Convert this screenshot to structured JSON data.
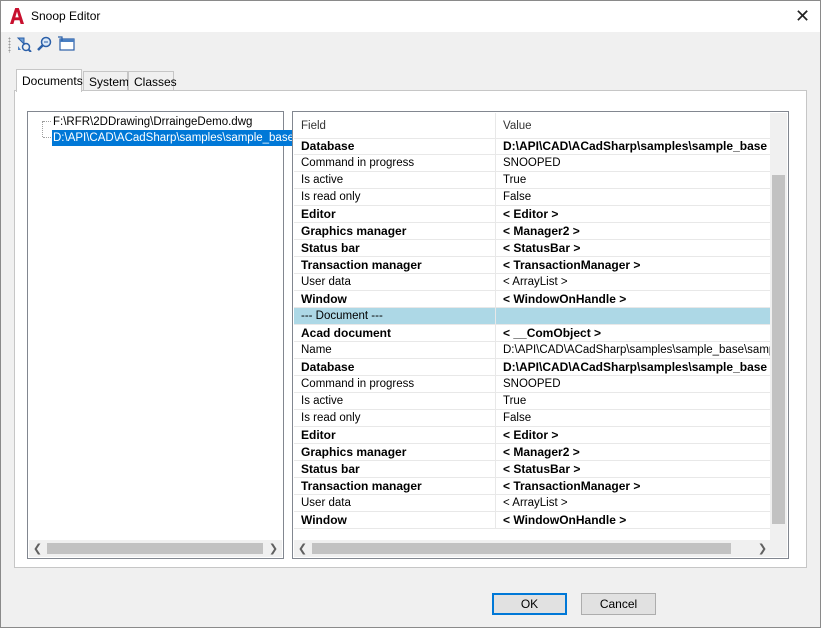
{
  "window": {
    "title": "Snoop Editor",
    "close_symbol": "✕"
  },
  "toolbar": {
    "buttons": [
      {
        "icon": "snoop-entity-icon"
      },
      {
        "icon": "snoop-zoom-icon"
      },
      {
        "icon": "snoop-window-icon"
      }
    ]
  },
  "tabs": [
    {
      "label": "Documents",
      "active": true
    },
    {
      "label": "System",
      "active": false
    },
    {
      "label": "Classes",
      "active": false
    }
  ],
  "tree": {
    "items": [
      {
        "label": "F:\\RFR\\2DDrawing\\DrraingeDemo.dwg",
        "selected": false
      },
      {
        "label": "D:\\API\\CAD\\ACadSharp\\samples\\sample_base",
        "selected": true
      }
    ]
  },
  "grid": {
    "columns": [
      "Field",
      "Value"
    ],
    "rows": [
      {
        "field": "Database",
        "value": "D:\\API\\CAD\\ACadSharp\\samples\\sample_base",
        "bold": true
      },
      {
        "field": "Command in progress",
        "value": "SNOOPED",
        "bold": false
      },
      {
        "field": "Is active",
        "value": "True",
        "bold": false
      },
      {
        "field": "Is read only",
        "value": "False",
        "bold": false
      },
      {
        "field": "Editor",
        "value": "< Editor >",
        "bold": true
      },
      {
        "field": "Graphics manager",
        "value": "< Manager2 >",
        "bold": true
      },
      {
        "field": "Status bar",
        "value": "< StatusBar >",
        "bold": true
      },
      {
        "field": "Transaction manager",
        "value": "< TransactionManager >",
        "bold": true
      },
      {
        "field": "User data",
        "value": "< ArrayList >",
        "bold": false
      },
      {
        "field": "Window",
        "value": "< WindowOnHandle >",
        "bold": true
      },
      {
        "field": "--- Document ---",
        "value": "",
        "bold": false,
        "section": true
      },
      {
        "field": "Acad document",
        "value": "< __ComObject >",
        "bold": true
      },
      {
        "field": "Name",
        "value": "D:\\API\\CAD\\ACadSharp\\samples\\sample_base\\sample_",
        "bold": false
      },
      {
        "field": "Database",
        "value": "D:\\API\\CAD\\ACadSharp\\samples\\sample_base",
        "bold": true
      },
      {
        "field": "Command in progress",
        "value": "SNOOPED",
        "bold": false
      },
      {
        "field": "Is active",
        "value": "True",
        "bold": false
      },
      {
        "field": "Is read only",
        "value": "False",
        "bold": false
      },
      {
        "field": "Editor",
        "value": "< Editor >",
        "bold": true
      },
      {
        "field": "Graphics manager",
        "value": "< Manager2 >",
        "bold": true
      },
      {
        "field": "Status bar",
        "value": "< StatusBar >",
        "bold": true
      },
      {
        "field": "Transaction manager",
        "value": "< TransactionManager >",
        "bold": true
      },
      {
        "field": "User data",
        "value": "< ArrayList >",
        "bold": false
      },
      {
        "field": "Window",
        "value": "< WindowOnHandle >",
        "bold": true
      }
    ]
  },
  "buttons": {
    "ok": "OK",
    "cancel": "Cancel"
  },
  "colors": {
    "selection": "#0078d7",
    "section_row": "#add8e6",
    "app_icon": "#c8102e"
  }
}
